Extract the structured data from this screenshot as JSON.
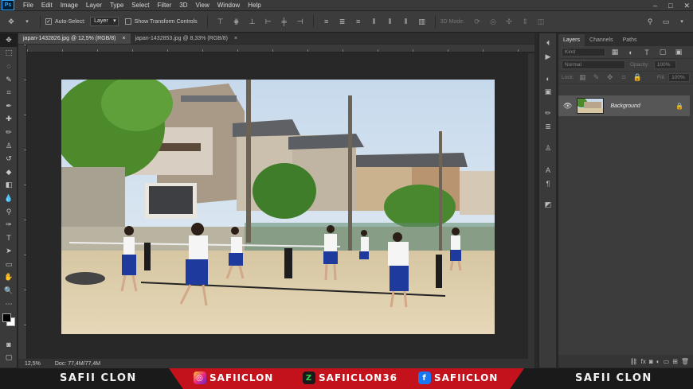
{
  "menubar": {
    "logo": "Ps",
    "items": [
      "File",
      "Edit",
      "Image",
      "Layer",
      "Type",
      "Select",
      "Filter",
      "3D",
      "View",
      "Window",
      "Help"
    ],
    "window_controls": [
      "–",
      "□",
      "✕"
    ]
  },
  "options": {
    "auto_select_label": "Auto-Select:",
    "auto_select_value": "Layer",
    "transform_label": "Show Transform Controls",
    "mode_3d_label": "3D Mode:"
  },
  "tabs": [
    {
      "label": "japan-1432826.jpg @ 12,5% (RGB/8)",
      "close": "×"
    },
    {
      "label": "japan-1432853.jpg @ 8,33% (RGB/8)",
      "close": "×"
    }
  ],
  "status": {
    "zoom": "12,5%",
    "doc": "Doc: 77,4M/77,4M"
  },
  "layers_panel": {
    "tabs": [
      "Layers",
      "Channels",
      "Paths"
    ],
    "kind_label": "Kind",
    "blend_mode": "Normal",
    "opacity_label": "Opacity:",
    "opacity_value": "100%",
    "lock_label": "Lock:",
    "fill_label": "Fill:",
    "fill_value": "100%",
    "layer_name": "Background"
  },
  "banner": {
    "left_brand": "SAFII CLON",
    "instagram": "SAFIICLON",
    "other": "SAFIICLON36",
    "facebook": "SAFIICLON",
    "right_brand": "SAFII CLON"
  },
  "colors": {
    "accent": "#31a8ff",
    "banner_red": "#c3121c"
  },
  "icons": {
    "tools": [
      "move-icon",
      "marquee-icon",
      "lasso-icon",
      "quick-select-icon",
      "crop-icon",
      "eyedropper-icon",
      "healing-icon",
      "brush-icon",
      "stamp-icon",
      "history-brush-icon",
      "eraser-icon",
      "bucket-icon",
      "blur-icon",
      "dodge-icon",
      "pen-icon",
      "type-icon",
      "path-select-icon",
      "rectangle-icon",
      "hand-icon",
      "zoom-icon",
      "more-icon"
    ]
  }
}
